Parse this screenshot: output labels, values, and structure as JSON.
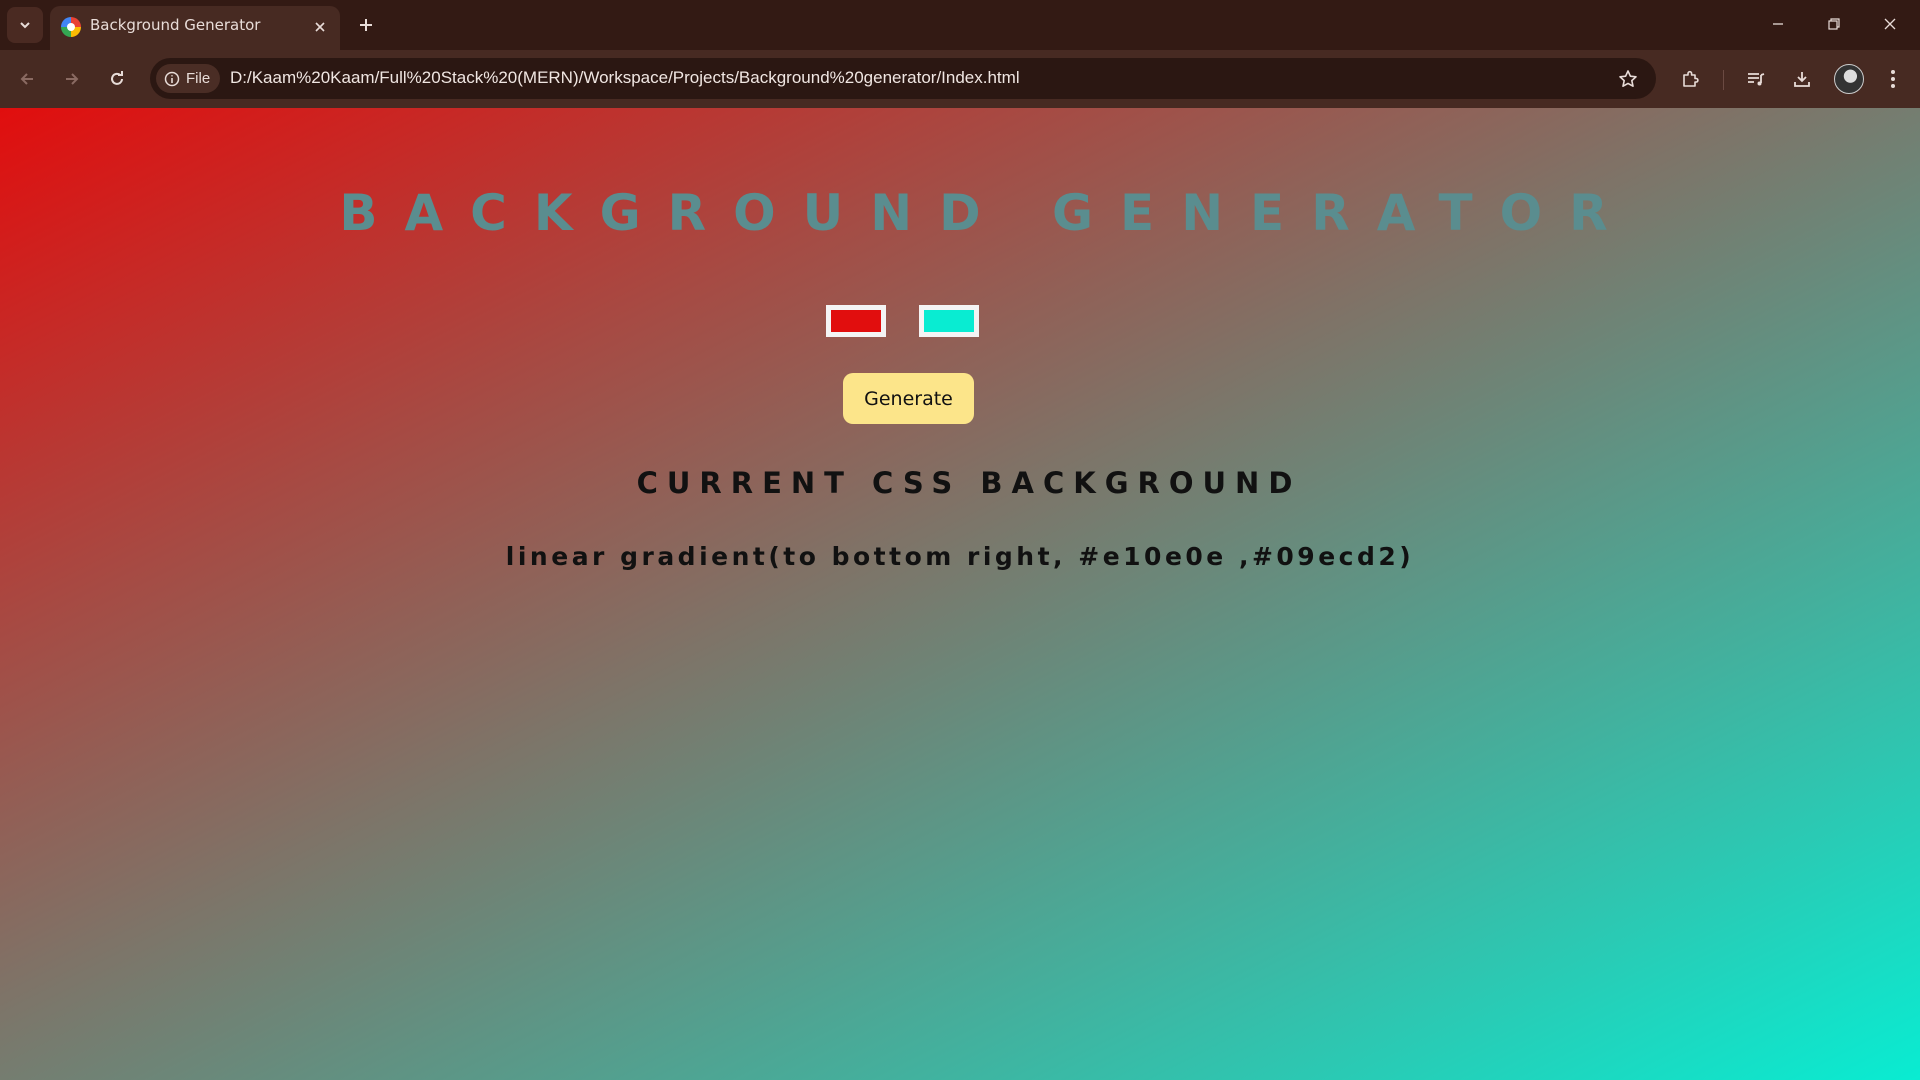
{
  "browser": {
    "tab": {
      "title": "Background Generator",
      "favicon": "chrome-page-favicon"
    },
    "icons": {
      "tab_search": "chevron-down-icon",
      "tab_close": "close-icon",
      "new_tab": "plus-icon",
      "minimize": "minimize-icon",
      "restore": "restore-icon",
      "close_window": "close-icon",
      "back": "arrow-left-icon",
      "forward": "arrow-right-icon",
      "reload": "reload-icon",
      "site_info": "info-icon",
      "bookmark": "star-icon",
      "extensions": "puzzle-icon",
      "media": "media-queue-icon",
      "downloads": "download-icon",
      "profile": "avatar",
      "menu": "kebab-menu-icon"
    },
    "omnibox": {
      "site_chip_label": "File",
      "url": "D:/Kaam%20Kaam/Full%20Stack%20(MERN)/Workspace/Projects/Background%20generator/Index.html"
    }
  },
  "page": {
    "heading": "BACKGROUND GENERATOR",
    "color1": "#e10e0e",
    "color2": "#09ecd2",
    "generate_label": "Generate",
    "css_heading": "CURRENT CSS BACKGROUND",
    "css_output": "linear gradient(to bottom right, #e10e0e ,#09ecd2)",
    "heading_color": "#5a8d8f",
    "button_color": "#fce58a"
  }
}
